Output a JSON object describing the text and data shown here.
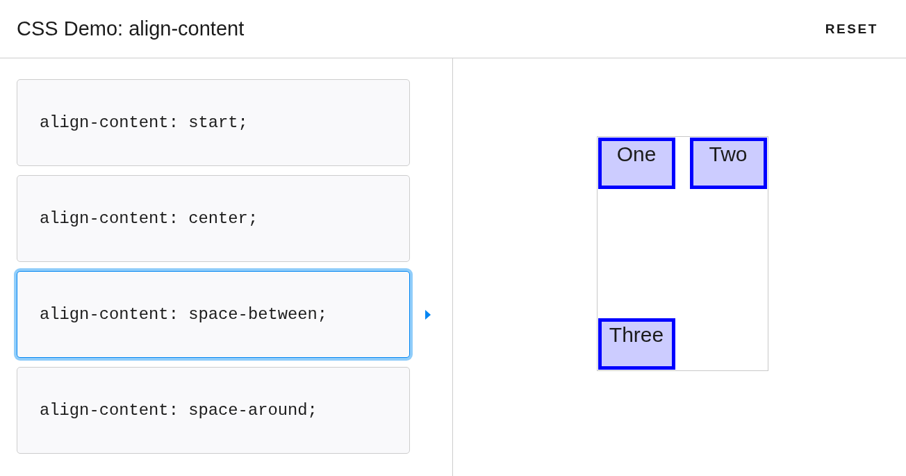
{
  "header": {
    "title": "CSS Demo: align-content",
    "reset_button": "RESET"
  },
  "options": [
    {
      "code": "align-content: start;",
      "selected": false
    },
    {
      "code": "align-content: center;",
      "selected": false
    },
    {
      "code": "align-content: space-between;",
      "selected": true
    },
    {
      "code": "align-content: space-around;",
      "selected": false
    }
  ],
  "demo": {
    "items": [
      "One",
      "Two",
      "Three"
    ]
  }
}
